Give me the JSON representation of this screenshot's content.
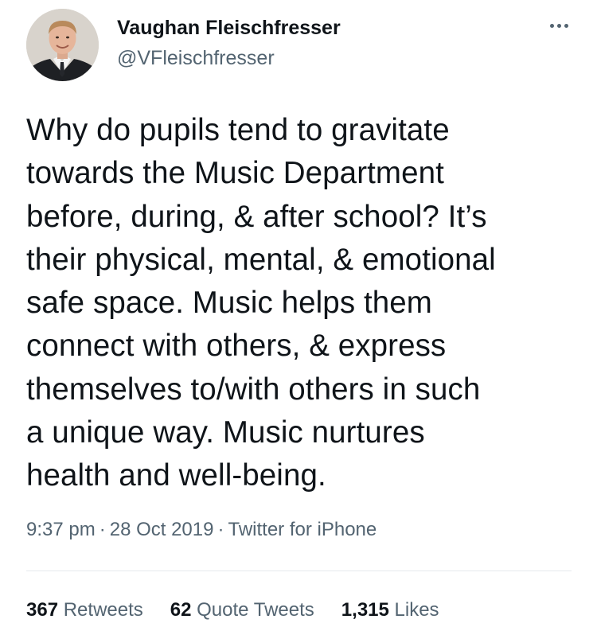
{
  "author": {
    "name": "Vaughan Fleischfresser",
    "handle": "@VFleischfresser",
    "avatar": "profile-photo"
  },
  "menu": {
    "icon": "more-icon"
  },
  "tweet": {
    "lines": [
      "Why do pupils tend to gravitate",
      "towards the Music Department",
      "before, during, & after school? It’s",
      "their physical, mental, & emotional",
      "safe space. Music helps them",
      "connect with others, & express",
      "themselves to/with others in such",
      "a unique way. Music nurtures",
      "health and well-being."
    ]
  },
  "meta": {
    "time": "9:37 pm",
    "date": "28 Oct 2019",
    "source": "Twitter for iPhone",
    "separator": "·"
  },
  "stats": {
    "retweets_count": "367",
    "retweets_label": "Retweets",
    "quotes_count": "62",
    "quotes_label": "Quote Tweets",
    "likes_count": "1,315",
    "likes_label": "Likes"
  },
  "colors": {
    "text": "#0f1419",
    "secondary": "#536471",
    "divider": "#e6e9ec"
  }
}
